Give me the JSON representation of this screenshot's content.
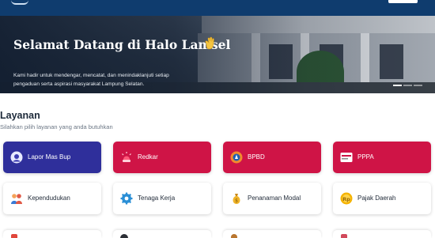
{
  "hero": {
    "title": "Selamat Datang di Halo Lamsel",
    "description": "Kami hadir untuk mendengar, mencatat, dan menindaklanjuti setiap pengaduan serta aspirasi masyarakat Lampung Selatan."
  },
  "section": {
    "title": "Layanan",
    "subtitle": "Silahkan pilih layanan yang anda butuhkan"
  },
  "services_row1": [
    {
      "label": "Lapor Mas Bup",
      "color": "#2f2f9b",
      "icon": "megaphone-icon"
    },
    {
      "label": "Redkar",
      "color": "#cf1446",
      "icon": "siren-icon"
    },
    {
      "label": "BPBD",
      "color": "#cf1446",
      "icon": "emblem-icon"
    },
    {
      "label": "PPPA",
      "color": "#cf1446",
      "icon": "logo-icon"
    }
  ],
  "services_row2": [
    {
      "label": "Kependudukan",
      "icon": "people-icon"
    },
    {
      "label": "Tenaga Kerja",
      "icon": "gear-icon"
    },
    {
      "label": "Penanaman Modal",
      "icon": "money-bag-icon"
    },
    {
      "label": "Pajak Daerah",
      "icon": "coin-icon"
    }
  ],
  "colors": {
    "navbar": "#0f3c6e",
    "accent_blue": "#2f2f9b",
    "accent_red": "#cf1446"
  }
}
